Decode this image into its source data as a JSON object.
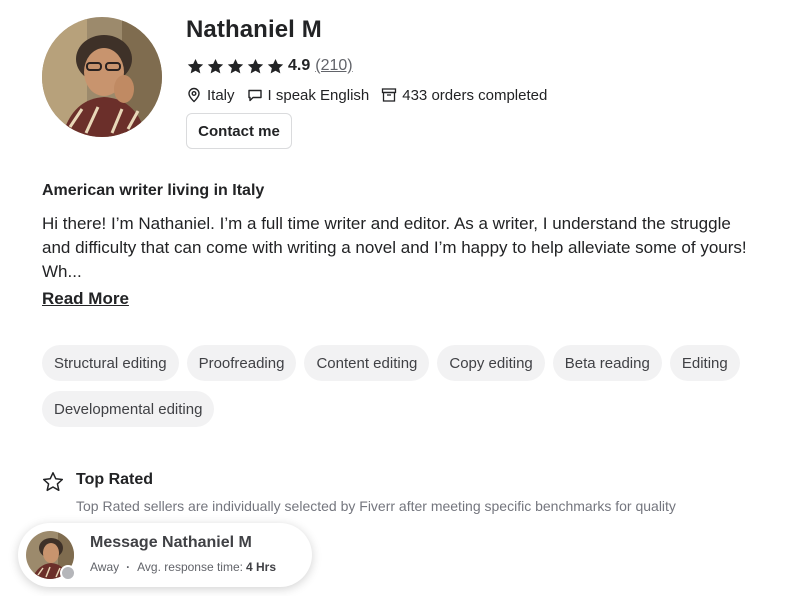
{
  "seller": {
    "name": "Nathaniel M",
    "rating": "4.9",
    "review_count": "(210)",
    "stars": 5,
    "location": "Italy",
    "languages": "I speak English",
    "orders": "433 orders completed",
    "contact_label": "Contact me"
  },
  "about": {
    "tagline": "American writer living in Italy",
    "description": "Hi there! I’m Nathaniel. I’m a full time writer and editor. As a writer, I understand the struggle and difficulty that can come with writing a novel and I’m happy to help alleviate some of yours! Wh...",
    "read_more": "Read More"
  },
  "skills": [
    "Structural editing",
    "Proofreading",
    "Content editing",
    "Copy editing",
    "Beta reading",
    "Editing",
    "Developmental editing"
  ],
  "top_rated": {
    "title": "Top Rated",
    "description": "Top Rated sellers are individually selected by Fiverr after meeting specific benchmarks for quality"
  },
  "message_card": {
    "title": "Message Nathaniel M",
    "status": "Away",
    "response_label": "Avg. response time:",
    "response_value": "4 Hrs"
  },
  "icons": {
    "star": "star-icon",
    "location": "location-pin-icon",
    "language": "speech-bubble-icon",
    "orders": "box-icon",
    "top_rated": "star-outline-icon"
  },
  "colors": {
    "text": "#222325",
    "muted": "#62646a",
    "chip_bg": "#f2f2f3",
    "away_dot": "#b5b6ba"
  }
}
